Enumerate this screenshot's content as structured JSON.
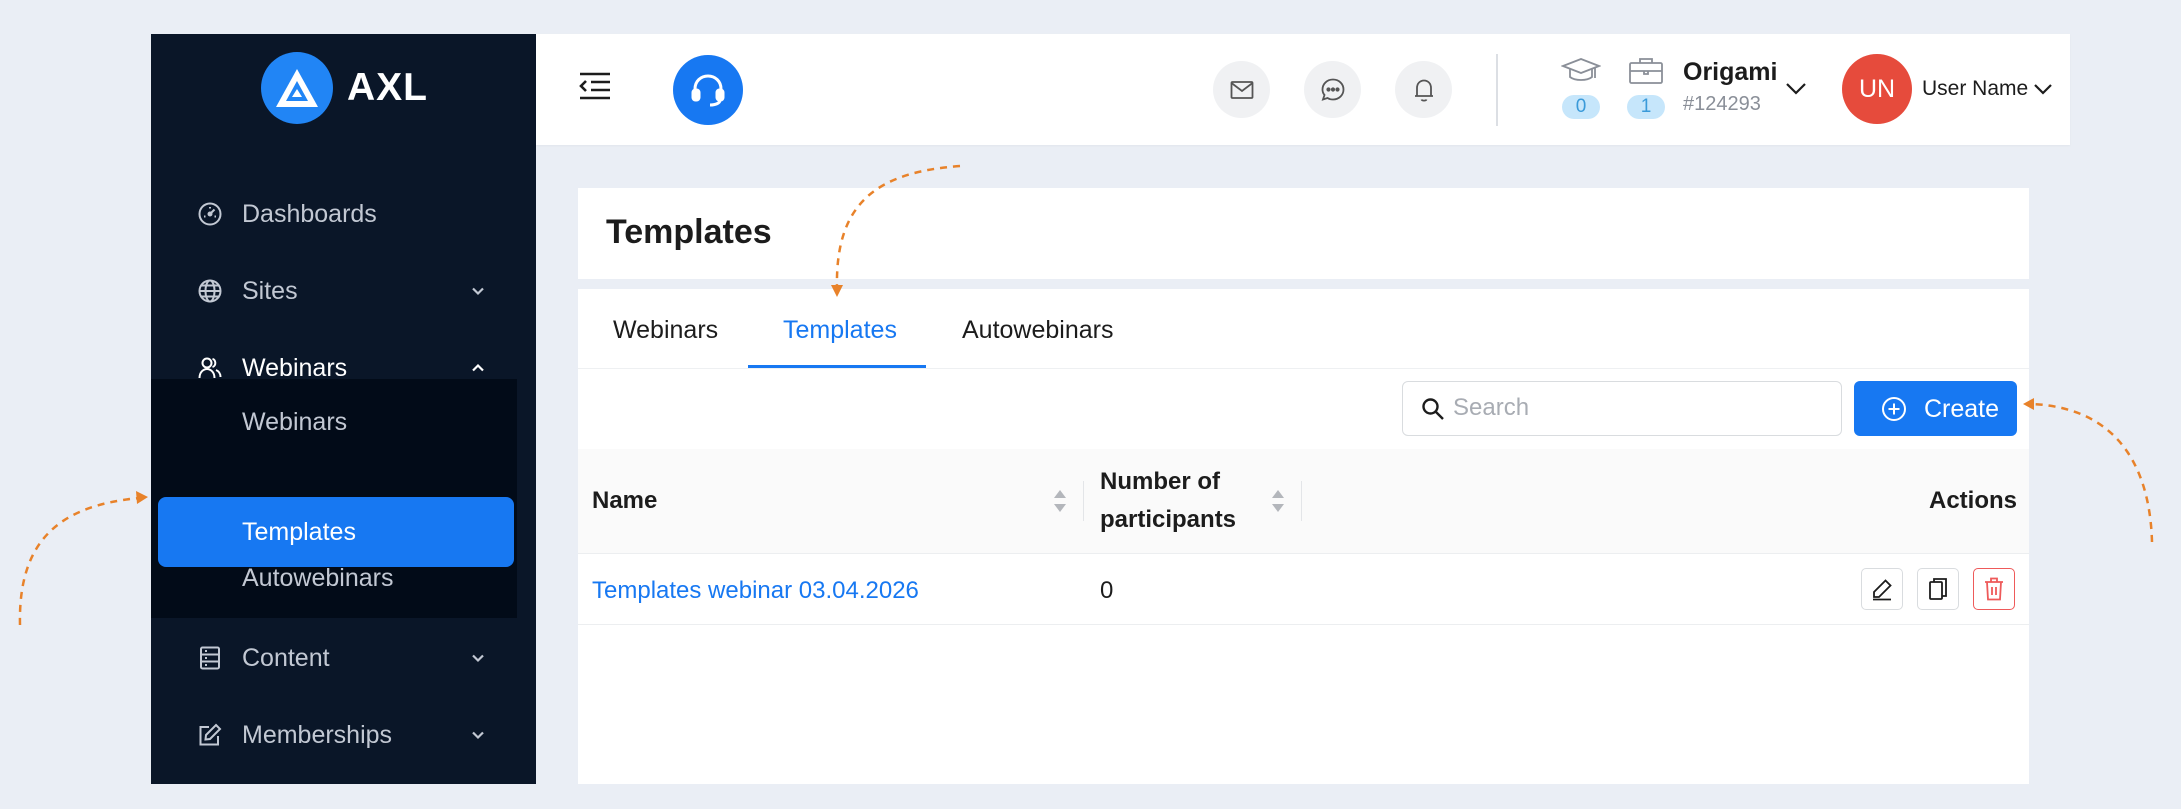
{
  "colors": {
    "sidebar_bg": "#0a1628",
    "accent": "#1778f2",
    "avatar": "#e64b3c",
    "annotation": "#e8822a",
    "danger": "#ee5a5a"
  },
  "sidebar": {
    "logo_text": "AXL",
    "items": [
      {
        "label": "Dashboards",
        "icon": "speedometer-icon"
      },
      {
        "label": "Sites",
        "icon": "globe-icon"
      },
      {
        "label": "Webinars",
        "icon": "user-group-icon"
      },
      {
        "label": "Content",
        "icon": "server-icon"
      },
      {
        "label": "Memberships",
        "icon": "edit-icon"
      }
    ],
    "submenu": [
      {
        "label": "Webinars"
      },
      {
        "label": "Templates"
      },
      {
        "label": "Autowebinars"
      }
    ]
  },
  "header": {
    "counters": [
      {
        "icon": "graduation-cap-icon",
        "value": "0"
      },
      {
        "icon": "briefcase-icon",
        "value": "1"
      }
    ],
    "org_name": "Origami",
    "org_id": "#124293",
    "avatar_initials": "UN",
    "user_name": "User Name"
  },
  "page": {
    "title": "Templates",
    "tabs": [
      {
        "label": "Webinars"
      },
      {
        "label": "Templates"
      },
      {
        "label": "Autowebinars"
      }
    ],
    "search_placeholder": "Search",
    "create_label": "Create"
  },
  "table": {
    "columns": {
      "name": "Name",
      "participants_line1": "Number of",
      "participants_line2": "participants",
      "actions": "Actions"
    },
    "rows": [
      {
        "name": "Templates webinar 03.04.2026",
        "participants": "0"
      }
    ]
  }
}
